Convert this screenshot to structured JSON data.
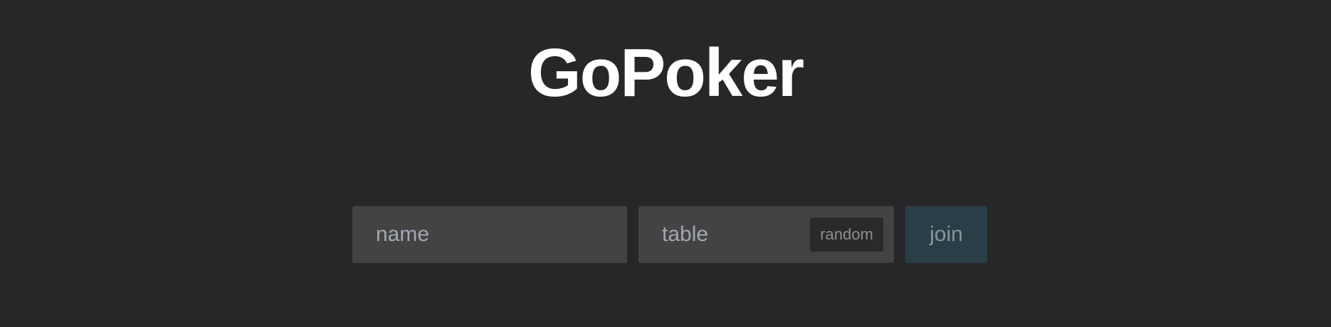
{
  "app": {
    "title": "GoPoker"
  },
  "form": {
    "name_placeholder": "name",
    "name_value": "",
    "table_placeholder": "table",
    "table_value": "",
    "random_label": "random",
    "join_label": "join"
  },
  "colors": {
    "background": "#27272a",
    "field_background": "#434343",
    "random_button_background": "#2a2a2a",
    "join_button_background": "#2a3e47",
    "title_text": "#ffffff",
    "placeholder_text": "#a3a7b3"
  }
}
